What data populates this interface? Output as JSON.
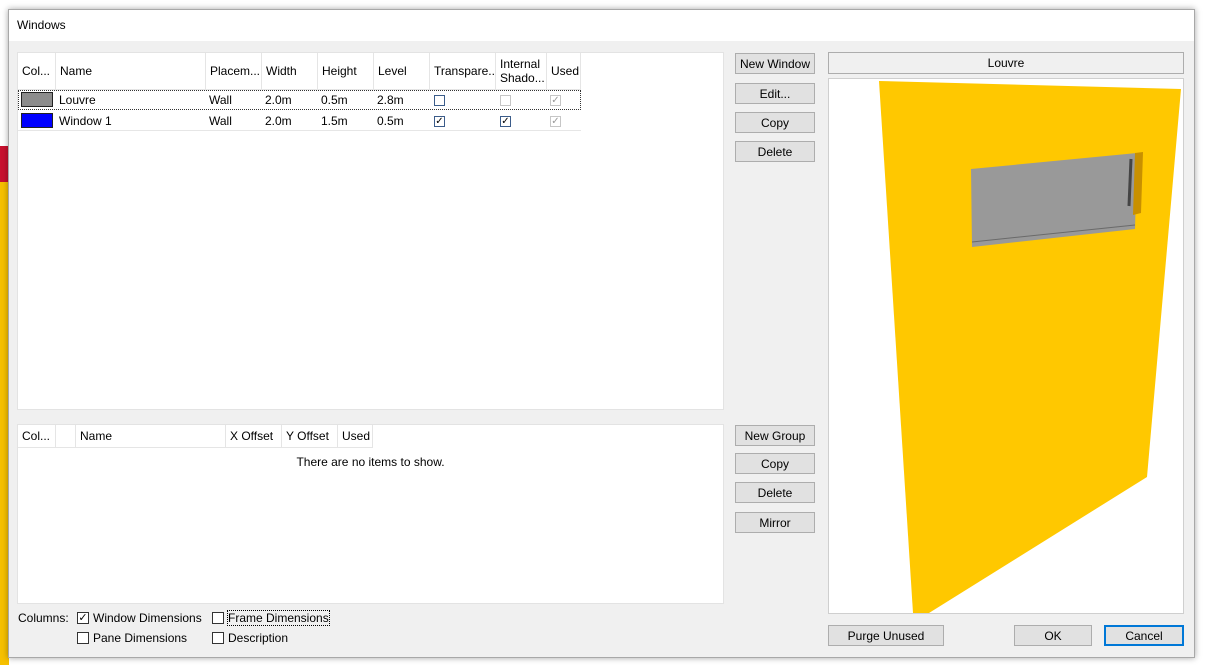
{
  "window": {
    "title": "Windows"
  },
  "windows_table": {
    "headers": [
      "Col...",
      "Name",
      "Placem...",
      "Width",
      "Height",
      "Level",
      "Transpare...",
      "Internal Shado...",
      "Used"
    ],
    "rows": [
      {
        "color": "#8c8c8c",
        "name": "Louvre",
        "placement": "Wall",
        "width": "2.0m",
        "height": "0.5m",
        "level": "2.8m",
        "transparent": false,
        "internal_shadow": false,
        "used": true
      },
      {
        "color": "#0000ff",
        "name": "Window 1",
        "placement": "Wall",
        "width": "2.0m",
        "height": "1.5m",
        "level": "0.5m",
        "transparent": true,
        "internal_shadow": true,
        "used": true
      }
    ]
  },
  "window_buttons": {
    "new": "New Window",
    "edit": "Edit...",
    "copy": "Copy",
    "delete": "Delete"
  },
  "groups_table": {
    "headers": [
      "Col...",
      "",
      "Name",
      "X Offset",
      "Y Offset",
      "Used"
    ],
    "empty_text": "There are no items to show."
  },
  "group_buttons": {
    "new": "New Group",
    "copy": "Copy",
    "delete": "Delete",
    "mirror": "Mirror"
  },
  "preview": {
    "label": "Louvre",
    "wall_color": "#ffc800",
    "glass_color": "#999999"
  },
  "columns": {
    "label": "Columns:",
    "window_dimensions": {
      "label": "Window Dimensions",
      "checked": true
    },
    "frame_dimensions": {
      "label": "Frame Dimensions",
      "checked": false
    },
    "pane_dimensions": {
      "label": "Pane Dimensions",
      "checked": false
    },
    "description": {
      "label": "Description",
      "checked": false
    }
  },
  "footer": {
    "purge": "Purge Unused",
    "ok": "OK",
    "cancel": "Cancel"
  }
}
